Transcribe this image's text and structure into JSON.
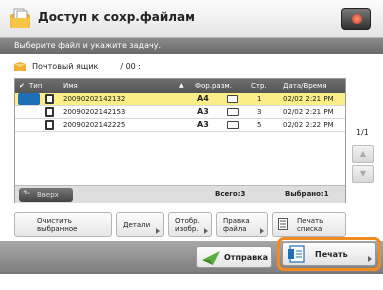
{
  "header": {
    "title": "Доступ к сохр.файлам",
    "icon": "folder-document-icon",
    "control_icon": "red-stop-icon"
  },
  "subbar": {
    "instruction": "Выберите файл и укажите задачу."
  },
  "mailbox": {
    "label": "Почтовый ящик",
    "number": "/ 00 :"
  },
  "table": {
    "columns": {
      "type": "Тип",
      "name": "Имя",
      "format": "Фор.разм.",
      "pages": "Стр.",
      "date": "Дата/Время"
    },
    "rows": [
      {
        "name": "20090202142132",
        "format": "A4",
        "pages": "1",
        "date": "02/02 2:21 PM",
        "selected": true
      },
      {
        "name": "20090202142153",
        "format": "A3",
        "pages": "3",
        "date": "02/02 2:21 PM",
        "selected": false
      },
      {
        "name": "20090202142225",
        "format": "A3",
        "pages": "5",
        "date": "02/02 2:22 PM",
        "selected": false
      }
    ],
    "up_button": "Вверх",
    "total": "Всего:3",
    "selected": "Выбрано:1"
  },
  "pager": {
    "page": "1/1"
  },
  "actions": {
    "clear": "Очистить выбранное",
    "details": "Детали",
    "display": "Отобр. изобр.",
    "edit": "Правка файла",
    "print_list": "Печать списка"
  },
  "bottom": {
    "send": "Отправка",
    "print": "Печать"
  },
  "colors": {
    "selected_row": "#fbee88",
    "highlight": "#f28a23",
    "header_bar": "#6e6e6e"
  }
}
